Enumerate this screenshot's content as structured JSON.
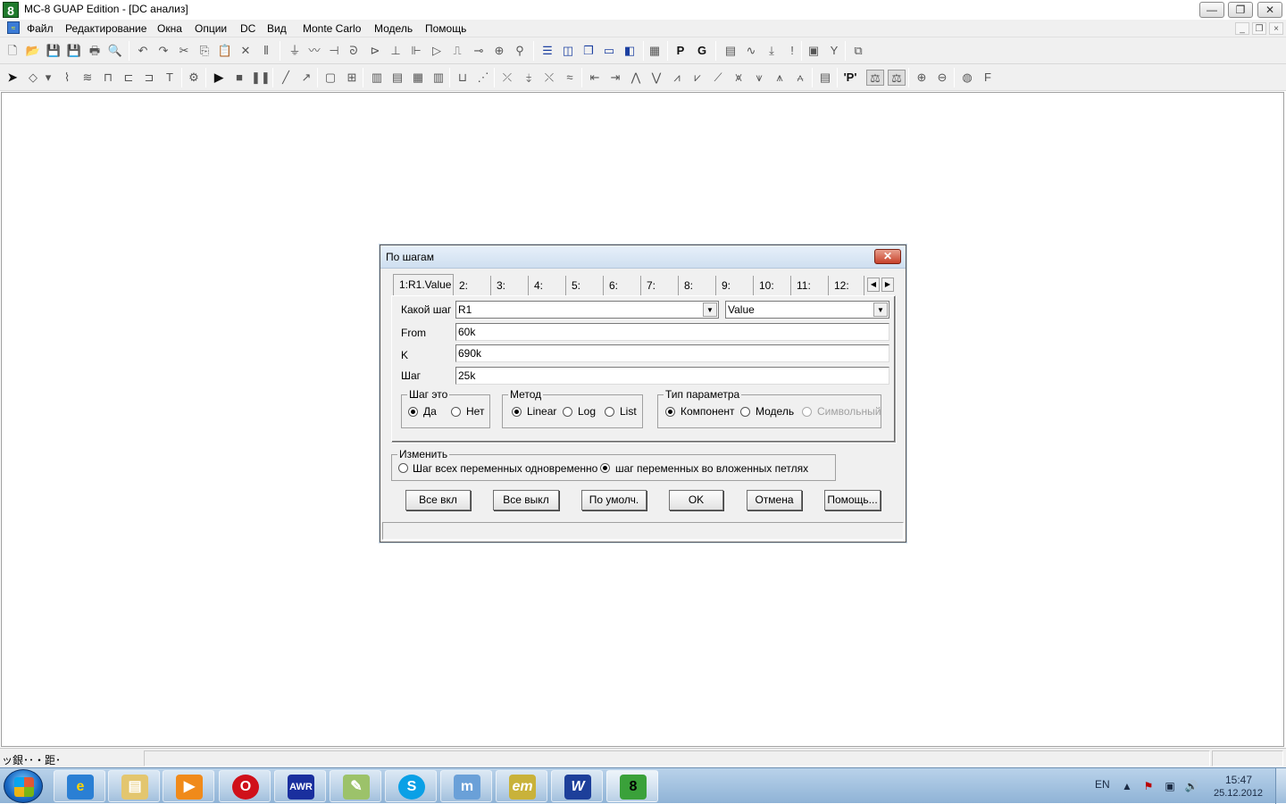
{
  "window": {
    "title": "MC-8 GUAP Edition - [DC анализ]",
    "app_icon": "8",
    "minimize": "—",
    "restore": "❐",
    "close": "✕"
  },
  "menu": {
    "items": [
      "Файл",
      "Редактирование",
      "Окна",
      "Опции",
      "DC",
      "Вид",
      "Monte Carlo",
      "Модель",
      "Помощь"
    ]
  },
  "status_bar": {
    "text": "ッ銀･･・距･"
  },
  "dialog": {
    "title": "По шагам",
    "close": "✕",
    "tabs": [
      "1:R1.Value",
      "2:",
      "3:",
      "4:",
      "5:",
      "6:",
      "7:",
      "8:",
      "9:",
      "10:",
      "11:",
      "12:"
    ],
    "step_label": "Какой шаг",
    "step_component": "R1",
    "step_property": "Value",
    "from_label": "From",
    "from_value": "60k",
    "k_label": "K",
    "k_value": "690k",
    "step_size_label": "Шаг",
    "step_size_value": "25k",
    "step_it_group": "Шаг это",
    "step_it_yes": "Да",
    "step_it_no": "Нет",
    "method_group": "Метод",
    "method_linear": "Linear",
    "method_log": "Log",
    "method_list": "List",
    "param_type_group": "Тип параметра",
    "param_component": "Компонент",
    "param_model": "Модель",
    "param_symbolic": "Символьный",
    "change_group": "Изменить",
    "change_all": "Шаг всех переменных одновременно",
    "change_nested": "шаг переменных во вложенных петлях",
    "buttons": {
      "all_on": "Все вкл",
      "all_off": "Все выкл",
      "default": "По умолч.",
      "ok": "OK",
      "cancel": "Отмена",
      "help": "Помощь..."
    }
  },
  "taskbar": {
    "lang": "EN",
    "time": "15:47",
    "date": "25.12.2012",
    "apps": [
      "internet-explorer",
      "file-explorer",
      "media-player",
      "opera",
      "awr",
      "notepad",
      "skype",
      "mathcad",
      "emachineshop",
      "word",
      "mc8"
    ]
  }
}
